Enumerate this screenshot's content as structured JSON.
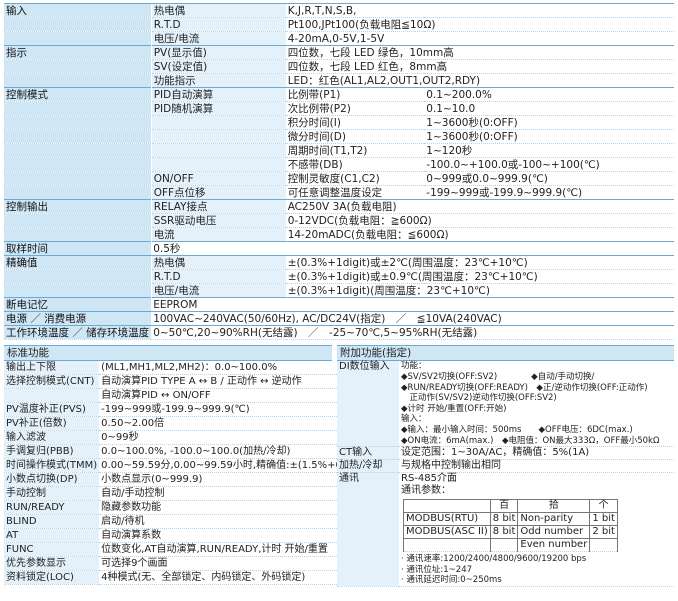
{
  "spec_rows": [
    {
      "c1": "输入",
      "c2": "热电偶",
      "c3": "K,J,R,T,N,S,B,",
      "c4": "",
      "sep": true
    },
    {
      "c1": "",
      "c2": "R.T.D",
      "c3": "Pt100,JPt100(负载电阻≦10Ω)",
      "c4": ""
    },
    {
      "c1": "",
      "c2": "电压/电流",
      "c3": "4-20mA,0-5V,1-5V",
      "c4": ""
    },
    {
      "c1": "指示",
      "c2": "PV(显示值)",
      "c3": "四位数，七段 LED 绿色，10mm高",
      "c4": "",
      "sep": true
    },
    {
      "c1": "",
      "c2": "SV(设定值)",
      "c3": "四位数，七段 LED 红色，8mm高",
      "c4": ""
    },
    {
      "c1": "",
      "c2": "功能指示",
      "c3": "LED：红色(AL1,AL2,OUT1,OUT2,RDY)",
      "c4": ""
    },
    {
      "c1": "控制模式",
      "c2": "PID自动演算",
      "c3": "比例带(P1)",
      "c4": "0.1~200.0%",
      "sep": true
    },
    {
      "c1": "",
      "c2": "PID随机演算",
      "c3": "次比例带(P2)",
      "c4": "0.1~10.0"
    },
    {
      "c1": "",
      "c2": "",
      "c3": "积分时间(I)",
      "c4": "1~3600秒(0:OFF)"
    },
    {
      "c1": "",
      "c2": "",
      "c3": "微分时间(D)",
      "c4": "1~3600秒(0:OFF)"
    },
    {
      "c1": "",
      "c2": "",
      "c3": "周期时间(T1,T2)",
      "c4": "1~120秒"
    },
    {
      "c1": "",
      "c2": "",
      "c3": "不感带(DB)",
      "c4": "-100.0~+100.0或-100~+100(℃)"
    },
    {
      "c1": "",
      "c2": "ON/OFF",
      "c3": "控制灵敏度(C1,C2)",
      "c4": "0~999或0.0~999.9(℃)"
    },
    {
      "c1": "",
      "c2": "OFF点位移",
      "c3": "可任意调整温度设定",
      "c4": "-199~999或-199.9~999.9(℃)"
    },
    {
      "c1": "控制输出",
      "c2": "RELAY接点",
      "c3": "AC250V 3A(负载电阻)",
      "c4": "",
      "sep": true
    },
    {
      "c1": "",
      "c2": "SSR驱动电压",
      "c3": "0-12VDC(负载电阻：≧600Ω)",
      "c4": ""
    },
    {
      "c1": "",
      "c2": "电流",
      "c3": "14-20mADC(负载电阻：≦600Ω)",
      "c4": ""
    },
    {
      "c1": "取样时间",
      "c2": "",
      "c3": "0.5秒",
      "c4": "",
      "sep": true
    },
    {
      "c1": "精确值",
      "c2": "热电偶",
      "c3": "±(0.3%+1digit)或±2℃(周围温度：23℃+10℃)",
      "c4": "",
      "sep": true
    },
    {
      "c1": "",
      "c2": "R.T.D",
      "c3": "±(0.3%+1digit)或±0.9℃(周围温度：23℃+10℃)",
      "c4": ""
    },
    {
      "c1": "",
      "c2": "电压/电流",
      "c3": "±(0.3%+1digit)(周围温度：23℃+10℃)",
      "c4": ""
    },
    {
      "c1": "断电记忆",
      "c2": "",
      "c3": "EEPROM",
      "c4": "",
      "sep": true
    },
    {
      "c1": "电源 ／ 消费电源",
      "c2": "",
      "c3": "100VAC~240VAC(50/60Hz), AC/DC24V(指定)　／　≦10VA(240VAC)",
      "c4": "",
      "sep": true
    },
    {
      "c1": "工作环境温度 ／ 储存环境温度",
      "c2": "",
      "c3": "0~50℃,20~90%RH(无结露)　／　-25~70℃,5~95%RH(无结露)",
      "c4": "",
      "sep": true
    }
  ],
  "std": {
    "title": "标准功能",
    "rows": [
      {
        "k": "输出上下限",
        "v": "(ML1,MH1,ML2,MH2)：0.0~100.0%"
      },
      {
        "k": "选择控制模式(CNT)",
        "v": "自动演算PID TYPE A ↔ B / 正动作 ↔ 逆动作"
      },
      {
        "k": "",
        "v": "自动演算PID ↔ ON/OFF"
      },
      {
        "k": "PV温度补正(PVS)",
        "v": "-199~999或-199.9~999.9(℃)"
      },
      {
        "k": "PV补正(倍数)",
        "v": "0.50~2.00倍"
      },
      {
        "k": "输入滤波",
        "v": "0~99秒"
      },
      {
        "k": "手调复归(PBB)",
        "v": "0.0~100.0%, -100.0~100.0(加热/冷却)"
      },
      {
        "k": "时间操作模式(TMM)",
        "v": "0.00~59.59分,0.00~99.59小时,精确值:±(1.5%+0.5秒)"
      },
      {
        "k": "小数点切换(DP)",
        "v": "小数点显示(0~999.9)"
      },
      {
        "k": "手动控制",
        "v": "自动/手动控制"
      },
      {
        "k": "RUN/READY",
        "v": "隐藏参数功能"
      },
      {
        "k": "BLIND",
        "v": "启动/待机"
      },
      {
        "k": "AT",
        "v": "自动演算系数"
      },
      {
        "k": "FUNC",
        "v": "位数变化,AT自动演算,RUN/READY,计时 开始/重置"
      },
      {
        "k": "优先参数显示",
        "v": "可选择9个画面"
      },
      {
        "k": "资料锁定(LOC)",
        "v": "4种模式(无、全部锁定、内码锁定、外码锁定)"
      }
    ]
  },
  "add": {
    "title": "附加功能(指定)",
    "di_label": "DI数位输入",
    "di_lines": [
      "功能：",
      "◆SV/SV2切换(OFF:SV2)　　　　◆自动/手动切换/",
      "◆RUN/READY切换(OFF:READY)　◆正/逆动作切换(OFF:正动作)",
      "　正动作(SV/SV2)逆动作切换(OFF:SV2)",
      "◆计时 开始/重置(OFF:开始)",
      "输入：",
      "◆输入：最小输入时间：500ms　　◆OFF电压：6DC(max.)",
      "◆ON电流：6mA(max.)　◆电阻值：ON最大333Ω，OFF最小50kΩ"
    ],
    "ct_label": "CT输入",
    "ct_value": "设定范围：1~30A/AC，精确值：5%(1A)",
    "heat_label": "加热/冷却",
    "heat_value": "与规格中控制输出相同",
    "comm_label": "通讯",
    "comm_line1": "RS-485介面",
    "comm_line2": "通讯参数：",
    "mini_head": [
      "",
      "百",
      "拾",
      "个"
    ],
    "mini_rows": [
      [
        "MODBUS(RTU)",
        "8 bit",
        "Non-parity",
        "1 bit"
      ],
      [
        "MODBUS(ASC II)",
        "8 bit",
        "Odd number",
        "2 bit"
      ],
      [
        "",
        "",
        "Even number",
        ""
      ]
    ],
    "comm_notes": [
      "· 通讯速率:1200/2400/4800/9600/19200 bps",
      "· 通讯位址:1~247",
      "· 通讯延迟时间:0~250ms"
    ]
  }
}
